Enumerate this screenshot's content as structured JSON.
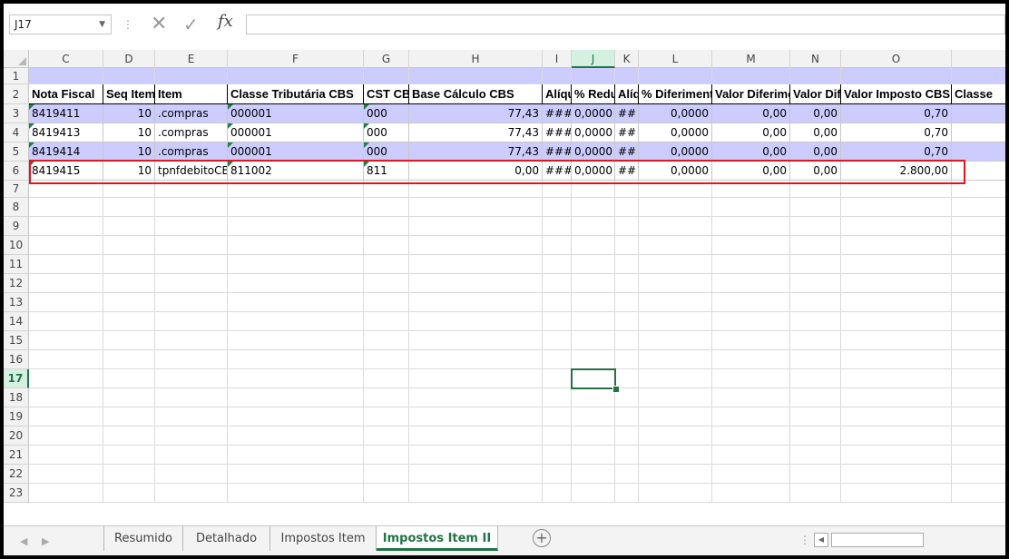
{
  "formula_bar": {
    "name_box": "J17",
    "cancel_icon": "✕",
    "enter_icon": "✓",
    "fx_label": "fx",
    "formula_value": ""
  },
  "columns": [
    "C",
    "D",
    "E",
    "F",
    "G",
    "H",
    "I",
    "J",
    "K",
    "L",
    "M",
    "N",
    "O"
  ],
  "active_column": "J",
  "rows": [
    "1",
    "2",
    "3",
    "4",
    "5",
    "6",
    "7",
    "8",
    "9",
    "10",
    "11",
    "12",
    "13",
    "14",
    "15",
    "16",
    "17",
    "18",
    "19",
    "20",
    "21",
    "22",
    "23"
  ],
  "active_row": "17",
  "header_row": [
    "Nota Fiscal",
    "Seq Item",
    "Item",
    "Classe Tributária CBS",
    "CST CBS",
    "Base Cálculo CBS",
    "Alíquota",
    "% Redução",
    "Alíquota",
    "% Diferimento",
    "Valor Diferimento",
    "Valor Dif",
    "Valor Imposto CBS",
    "Classe"
  ],
  "data_rows": [
    [
      "8419411",
      "10",
      ".compras",
      "000001",
      "000",
      "77,43",
      "###",
      "0,0000",
      "##",
      "0,0000",
      "0,00",
      "0,00",
      "0,70",
      ""
    ],
    [
      "8419413",
      "10",
      ".compras",
      "000001",
      "000",
      "77,43",
      "###",
      "0,0000",
      "##",
      "0,0000",
      "0,00",
      "0,00",
      "0,70",
      ""
    ],
    [
      "8419414",
      "10",
      ".compras",
      "000001",
      "000",
      "77,43",
      "###",
      "0,0000",
      "##",
      "0,0000",
      "0,00",
      "0,00",
      "0,70",
      ""
    ],
    [
      "8419415",
      "10",
      "tpnfdebitoCBS",
      "811002",
      "811",
      "0,00",
      "###",
      "0,0000",
      "##",
      "0,0000",
      "0,00",
      "0,00",
      "2.800,00",
      ""
    ]
  ],
  "sheet_tabs": [
    "Resumido",
    "Detalhado",
    "Impostos Item",
    "Impostos Item II"
  ],
  "active_tab": "Impostos Item II",
  "add_sheet_label": "+",
  "colors": {
    "accent": "#217346",
    "band": "#ccccff",
    "highlight": "#e3161c"
  }
}
